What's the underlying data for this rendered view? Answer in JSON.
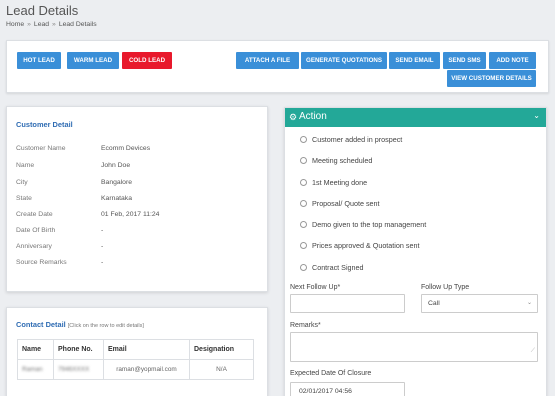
{
  "header": {
    "title": "Lead Details",
    "breadcrumb": [
      "Home",
      "Lead",
      "Lead Details"
    ],
    "separator": "»"
  },
  "toolbar": {
    "hot_lead": "HOT LEAD",
    "warm_lead": "WARM LEAD",
    "cold_lead": "COLD LEAD",
    "attach_file": "ATTACH A FILE",
    "generate_quotations": "GENERATE QUOTATIONS",
    "send_email": "SEND EMAIL",
    "send_sms": "SEND SMS",
    "add_note": "ADD NOTE",
    "view_customer_details": "VIEW CUSTOMER DETAILS"
  },
  "customer_detail": {
    "title": "Customer Detail",
    "rows": [
      {
        "label": "Customer Name",
        "value": "Ecomm Devices"
      },
      {
        "label": "Name",
        "value": "John Doe"
      },
      {
        "label": "City",
        "value": "Bangalore"
      },
      {
        "label": "State",
        "value": "Karnataka"
      },
      {
        "label": "Create Date",
        "value": "01 Feb, 2017 11:24"
      },
      {
        "label": "Date Of Birth",
        "value": "-"
      },
      {
        "label": "Anniversary",
        "value": "-"
      },
      {
        "label": "Source Remarks",
        "value": "-"
      }
    ]
  },
  "contact_detail": {
    "title": "Contact Detail",
    "hint": "[Click on the row to edit details]",
    "columns": [
      "Name",
      "Phone No.",
      "Email",
      "Designation"
    ],
    "rows": [
      {
        "name": "Raman",
        "phone": "7946XXXX",
        "email": "raman@yopmail.com",
        "designation": "N/A"
      }
    ]
  },
  "action": {
    "title": "Action",
    "steps": [
      "Customer added in prospect",
      "Meeting scheduled",
      "1st Meeting done",
      "Proposal/ Quote sent",
      "Demo given to the top management",
      "Prices approved & Quotation sent",
      "Contract Signed"
    ],
    "next_follow_up_label": "Next Follow Up*",
    "next_follow_up_value": "",
    "follow_up_type_label": "Follow Up Type",
    "follow_up_type_value": "Call",
    "remarks_label": "Remarks*",
    "remarks_value": "",
    "closure_label": "Expected Date Of Closure",
    "closure_value": "02/01/2017 04:56"
  },
  "colors": {
    "primary_button": "#3a8fd8",
    "cold_lead_button": "#e8192c",
    "action_header": "#23a898",
    "card_title": "#2f6cb3"
  }
}
